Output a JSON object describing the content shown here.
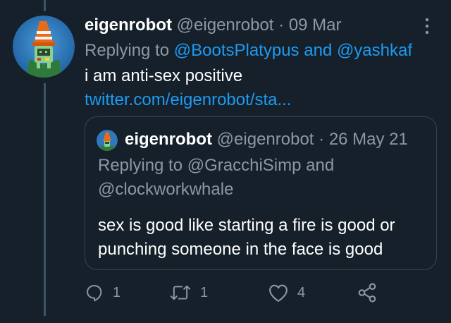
{
  "tweet": {
    "display_name": "eigenrobot",
    "handle": "@eigenrobot",
    "separator": "·",
    "date": "09 Mar",
    "replying_prefix": "Replying to",
    "replying_to_1": "@BootsPlatypus",
    "replying_and": "and",
    "replying_to_2": "@yashkaf",
    "text": "i am anti-sex positive",
    "link": "twitter.com/eigenrobot/sta..."
  },
  "quote": {
    "display_name": "eigenrobot",
    "handle": "@eigenrobot",
    "separator": "·",
    "date": "26 May 21",
    "replying_line": "Replying to @GracchiSimp and @clockworkwhale",
    "text": "sex is good like starting a fire is good or punching someone in the face is good"
  },
  "actions": {
    "reply_count": "1",
    "retweet_count": "1",
    "like_count": "4"
  },
  "icons": {
    "more": "more-vertical-icon",
    "reply": "reply-icon",
    "retweet": "retweet-icon",
    "like": "heart-icon",
    "share": "share-icon"
  },
  "colors": {
    "background": "#15202b",
    "text": "#ffffff",
    "secondary": "#8b98a5",
    "link": "#1d9bf0",
    "border": "#38444d",
    "thread_line": "#3d5466"
  }
}
